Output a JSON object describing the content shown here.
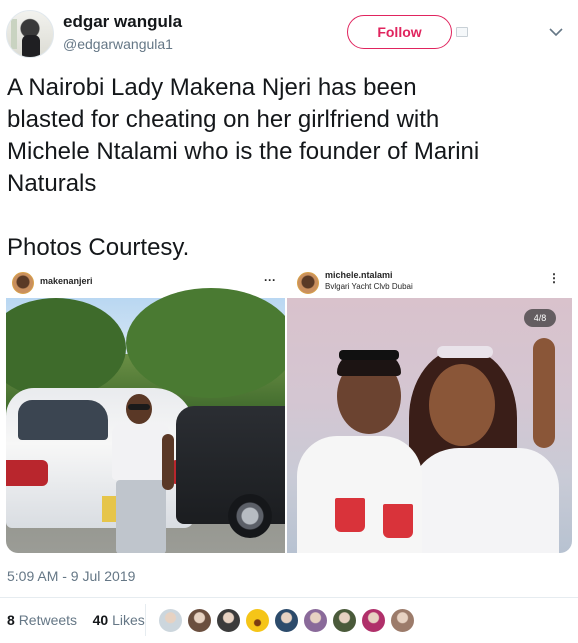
{
  "author": {
    "display_name": "edgar wangula",
    "handle": "@edgarwangula1",
    "follow_label": "Follow"
  },
  "tweet": {
    "text": "A Nairobi Lady Makena Njeri has been\nblasted for cheating on her girlfriend with\nMichele Ntalami who is the founder of Marini\nNaturals\n\nPhotos Courtesy."
  },
  "photos": [
    {
      "username": "makenanjeri",
      "menu": "···"
    },
    {
      "username": "michele.ntalami",
      "location": "Bvlgari Yacht Clvb Dubai",
      "menu": "⋮",
      "counter": "4/8"
    }
  ],
  "meta": {
    "timestamp": "5:09 AM - 9 Jul 2019"
  },
  "stats": {
    "retweets_count": "8",
    "retweets_label": "Retweets",
    "likes_count": "40",
    "likes_label": "Likes"
  },
  "likers": [
    {
      "icon": "default-avatar",
      "color": "#ccd6dd"
    },
    {
      "icon": "user-avatar",
      "color": "#6b4f3f"
    },
    {
      "icon": "user-avatar",
      "color": "#3b3b3b"
    },
    {
      "icon": "emoji-avatar",
      "color": "#f5c518"
    },
    {
      "icon": "user-avatar",
      "color": "#2c4b6b"
    },
    {
      "icon": "user-avatar",
      "color": "#8a6a9a"
    },
    {
      "icon": "user-avatar",
      "color": "#4a5a3a"
    },
    {
      "icon": "user-avatar",
      "color": "#b0306a"
    },
    {
      "icon": "user-avatar",
      "color": "#9c7b6a"
    }
  ],
  "colors": {
    "follow": "#e0245e",
    "secondary_text": "#657786",
    "primary_text": "#14171a"
  }
}
